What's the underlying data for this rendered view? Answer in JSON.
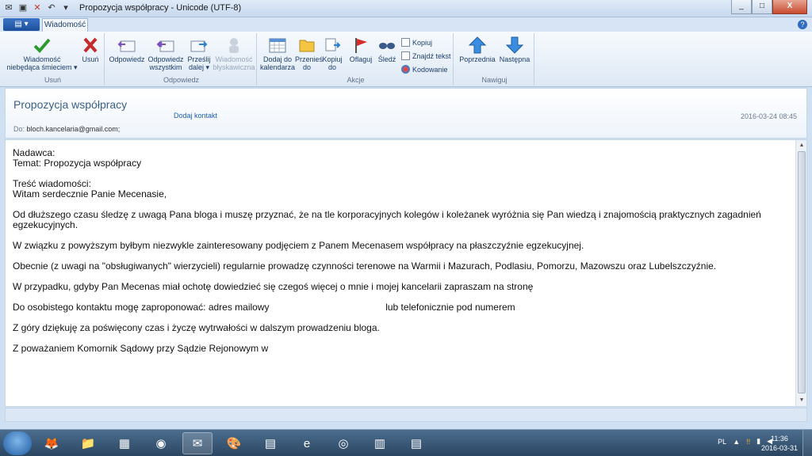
{
  "window": {
    "title": "Propozycja współpracy - Unicode (UTF-8)",
    "controls": {
      "minimize": "_",
      "maximize": "□",
      "close": "X"
    }
  },
  "ribbon": {
    "file_icon": "file-menu-icon",
    "active_tab": "Wiadomość",
    "groups": {
      "usun": {
        "label": "Usuń",
        "not_junk": "Wiadomość niebędąca śmieciem",
        "delete": "Usuń"
      },
      "odpowiedz": {
        "label": "Odpowiedz",
        "reply": "Odpowiedz",
        "reply_all": "Odpowiedz wszystkim",
        "forward": "Prześlij dalej",
        "im": "Wiadomość błyskawiczna"
      },
      "akcje": {
        "label": "Akcje",
        "add_to_calendar": "Dodaj do kalendarza",
        "move_to": "Przenieś do",
        "copy_to": "Kopiuj do",
        "flag": "Oflaguj",
        "watch": "Śledź",
        "copy": "Kopiuj",
        "find": "Znajdź tekst",
        "encoding": "Kodowanie"
      },
      "nawiguj": {
        "label": "Nawiguj",
        "previous": "Poprzednia",
        "next": "Następna"
      }
    }
  },
  "message": {
    "subject": "Propozycja współpracy",
    "add_contact": "Dodaj kontakt",
    "date": "2016-03-24 08:45",
    "to_label": "Do:",
    "to_value": "bloch.kancelaria@gmail.com;",
    "body": [
      "Nadawca:",
      "Temat: Propozycja współpracy",
      "",
      "Treść wiadomości:",
      "Witam serdecznie Panie Mecenasie,",
      "",
      "Od dłuższego czasu śledzę z uwagą Pana bloga i muszę przyznać, że na tle korporacyjnych kolegów i koleżanek wyróżnia się Pan wiedzą i znajomością praktycznych zagadnień egzekucyjnych.",
      "",
      "W związku z powyższym byłbym niezwykle zainteresowany podjęciem z Panem Mecenasem współpracy na płaszczyźnie egzekucyjnej.",
      "",
      "Obecnie (z uwagi na \"obsługiwanych\" wierzycieli) regularnie prowadzę czynności terenowe na Warmii i Mazurach, Podlasiu, Pomorzu, Mazowszu oraz Lubelszczyźnie.",
      "",
      "W przypadku, gdyby Pan Mecenas miał ochotę dowiedzieć się czegoś więcej o mnie i mojej kancelarii zapraszam na stronę",
      "",
      "Do osobistego kontaktu mogę zaproponować: adres mailowy                                            lub telefonicznie pod numerem",
      "",
      "Z góry dziękuję za poświęcony czas i życzę wytrwałości w dalszym prowadzeniu bloga.",
      "",
      "Z poważaniem Komornik Sądowy przy Sądzie Rejonowym w"
    ]
  },
  "taskbar": {
    "language": "PL",
    "time": "11:36",
    "date": "2016-03-31"
  },
  "colors": {
    "accent": "#1e3f6e",
    "link": "#1a5fb4",
    "taskbar": "#2a4560"
  }
}
